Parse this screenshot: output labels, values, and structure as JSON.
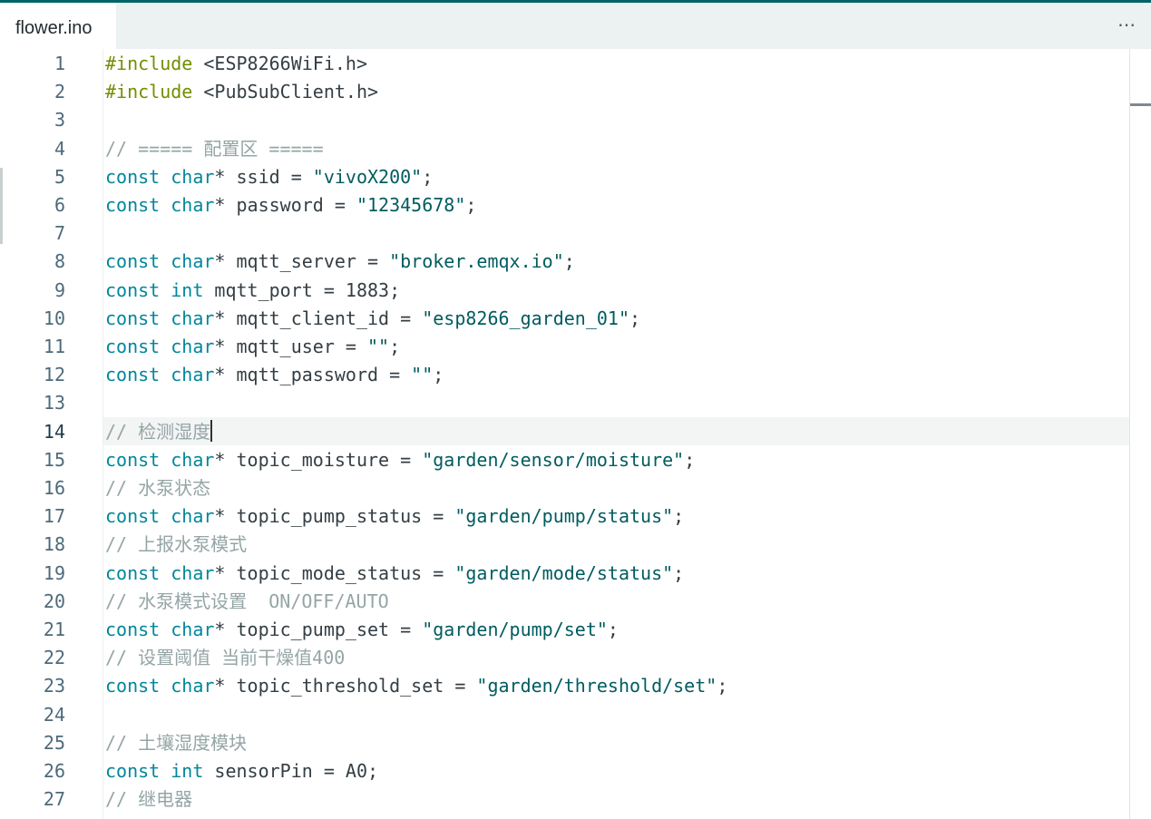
{
  "tab": {
    "filename": "flower.ino"
  },
  "toolbar": {
    "more_icon": "⋯"
  },
  "editor": {
    "current_line": 14,
    "lines": [
      {
        "n": "1",
        "tokens": [
          {
            "t": "pp",
            "v": "#include"
          },
          {
            "t": "plain",
            "v": " <ESP8266WiFi.h>"
          }
        ]
      },
      {
        "n": "2",
        "tokens": [
          {
            "t": "pp",
            "v": "#include"
          },
          {
            "t": "plain",
            "v": " <PubSubClient.h>"
          }
        ]
      },
      {
        "n": "3",
        "tokens": []
      },
      {
        "n": "4",
        "tokens": [
          {
            "t": "cm",
            "v": "// ===== 配置区 ====="
          }
        ]
      },
      {
        "n": "5",
        "tokens": [
          {
            "t": "kw",
            "v": "const char"
          },
          {
            "t": "plain",
            "v": "* ssid = "
          },
          {
            "t": "str",
            "v": "\"vivoX200\""
          },
          {
            "t": "plain",
            "v": ";"
          }
        ]
      },
      {
        "n": "6",
        "tokens": [
          {
            "t": "kw",
            "v": "const char"
          },
          {
            "t": "plain",
            "v": "* password = "
          },
          {
            "t": "str",
            "v": "\"12345678\""
          },
          {
            "t": "plain",
            "v": ";"
          }
        ]
      },
      {
        "n": "7",
        "tokens": []
      },
      {
        "n": "8",
        "tokens": [
          {
            "t": "kw",
            "v": "const char"
          },
          {
            "t": "plain",
            "v": "* mqtt_server = "
          },
          {
            "t": "str",
            "v": "\"broker.emqx.io\""
          },
          {
            "t": "plain",
            "v": ";"
          }
        ]
      },
      {
        "n": "9",
        "tokens": [
          {
            "t": "kw",
            "v": "const int"
          },
          {
            "t": "plain",
            "v": " mqtt_port = 1883;"
          }
        ]
      },
      {
        "n": "10",
        "tokens": [
          {
            "t": "kw",
            "v": "const char"
          },
          {
            "t": "plain",
            "v": "* mqtt_client_id = "
          },
          {
            "t": "str",
            "v": "\"esp8266_garden_01\""
          },
          {
            "t": "plain",
            "v": ";"
          }
        ]
      },
      {
        "n": "11",
        "tokens": [
          {
            "t": "kw",
            "v": "const char"
          },
          {
            "t": "plain",
            "v": "* mqtt_user = "
          },
          {
            "t": "str",
            "v": "\"\""
          },
          {
            "t": "plain",
            "v": ";"
          }
        ]
      },
      {
        "n": "12",
        "tokens": [
          {
            "t": "kw",
            "v": "const char"
          },
          {
            "t": "plain",
            "v": "* mqtt_password = "
          },
          {
            "t": "str",
            "v": "\"\""
          },
          {
            "t": "plain",
            "v": ";"
          }
        ]
      },
      {
        "n": "13",
        "tokens": []
      },
      {
        "n": "14",
        "tokens": [
          {
            "t": "cm",
            "v": "// 检测湿度"
          }
        ],
        "caret": true
      },
      {
        "n": "15",
        "tokens": [
          {
            "t": "kw",
            "v": "const char"
          },
          {
            "t": "plain",
            "v": "* topic_moisture = "
          },
          {
            "t": "str",
            "v": "\"garden/sensor/moisture\""
          },
          {
            "t": "plain",
            "v": ";"
          }
        ]
      },
      {
        "n": "16",
        "tokens": [
          {
            "t": "cm",
            "v": "// 水泵状态"
          }
        ]
      },
      {
        "n": "17",
        "tokens": [
          {
            "t": "kw",
            "v": "const char"
          },
          {
            "t": "plain",
            "v": "* topic_pump_status = "
          },
          {
            "t": "str",
            "v": "\"garden/pump/status\""
          },
          {
            "t": "plain",
            "v": ";"
          }
        ]
      },
      {
        "n": "18",
        "tokens": [
          {
            "t": "cm",
            "v": "// 上报水泵模式"
          }
        ]
      },
      {
        "n": "19",
        "tokens": [
          {
            "t": "kw",
            "v": "const char"
          },
          {
            "t": "plain",
            "v": "* topic_mode_status = "
          },
          {
            "t": "str",
            "v": "\"garden/mode/status\""
          },
          {
            "t": "plain",
            "v": ";"
          }
        ]
      },
      {
        "n": "20",
        "tokens": [
          {
            "t": "cm",
            "v": "// 水泵模式设置  ON/OFF/AUTO"
          }
        ]
      },
      {
        "n": "21",
        "tokens": [
          {
            "t": "kw",
            "v": "const char"
          },
          {
            "t": "plain",
            "v": "* topic_pump_set = "
          },
          {
            "t": "str",
            "v": "\"garden/pump/set\""
          },
          {
            "t": "plain",
            "v": ";"
          }
        ]
      },
      {
        "n": "22",
        "tokens": [
          {
            "t": "cm",
            "v": "// 设置阈值 当前干燥值400"
          }
        ]
      },
      {
        "n": "23",
        "tokens": [
          {
            "t": "kw",
            "v": "const char"
          },
          {
            "t": "plain",
            "v": "* topic_threshold_set = "
          },
          {
            "t": "str",
            "v": "\"garden/threshold/set\""
          },
          {
            "t": "plain",
            "v": ";"
          }
        ]
      },
      {
        "n": "24",
        "tokens": []
      },
      {
        "n": "25",
        "tokens": [
          {
            "t": "cm",
            "v": "// 土壤湿度模块"
          }
        ]
      },
      {
        "n": "26",
        "tokens": [
          {
            "t": "kw",
            "v": "const int"
          },
          {
            "t": "plain",
            "v": " sensorPin = A0;"
          }
        ]
      },
      {
        "n": "27",
        "tokens": [
          {
            "t": "cm",
            "v": "// 继电器"
          }
        ]
      }
    ]
  }
}
